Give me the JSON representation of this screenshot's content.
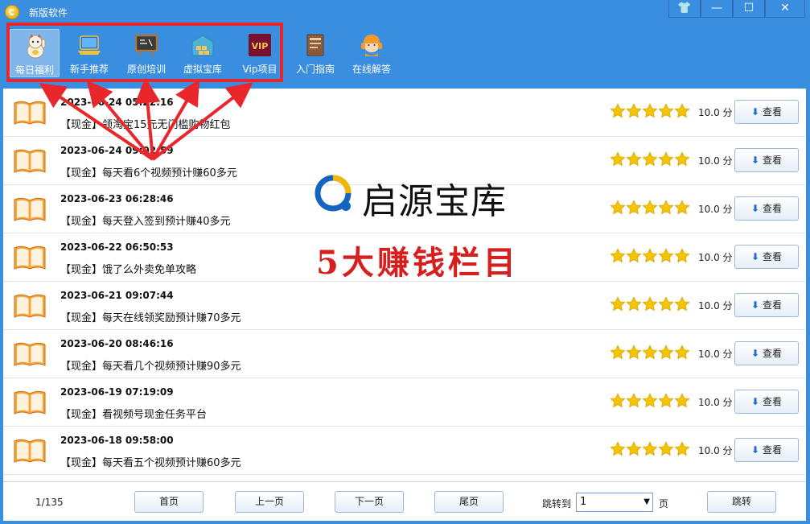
{
  "window": {
    "title": "新版软件"
  },
  "window_controls": {
    "skin": "👕",
    "minimize": "—",
    "maximize": "☐",
    "close": "✕"
  },
  "toolbar": [
    {
      "label": "每日福利",
      "icon": "lucky-cat-icon"
    },
    {
      "label": "新手推荐",
      "icon": "laptop-icon"
    },
    {
      "label": "原创培训",
      "icon": "chalkboard-icon"
    },
    {
      "label": "虚拟宝库",
      "icon": "warehouse-icon"
    },
    {
      "label": "Vip项目",
      "icon": "vip-icon",
      "badge": "VIP"
    },
    {
      "label": "入门指南",
      "icon": "guide-book-icon"
    },
    {
      "label": "在线解答",
      "icon": "support-agent-icon"
    }
  ],
  "rows": [
    {
      "date": "2023-06-24 05:22:16",
      "title": "【现金】领淘宝15元无门槛购物红包",
      "rating": 5,
      "score": "10.0 分",
      "button": "查看"
    },
    {
      "date": "2023-06-24 09:02:59",
      "title": "【现金】每天看6个视频预计赚60多元",
      "rating": 5,
      "score": "10.0 分",
      "button": "查看"
    },
    {
      "date": "2023-06-23 06:28:46",
      "title": "【现金】每天登入签到预计赚40多元",
      "rating": 5,
      "score": "10.0 分",
      "button": "查看"
    },
    {
      "date": "2023-06-22 06:50:53",
      "title": "【现金】饿了么外卖免单攻略",
      "rating": 5,
      "score": "10.0 分",
      "button": "查看"
    },
    {
      "date": "2023-06-21 09:07:44",
      "title": "【现金】每天在线领奖励预计赚70多元",
      "rating": 5,
      "score": "10.0 分",
      "button": "查看"
    },
    {
      "date": "2023-06-20 08:46:16",
      "title": "【现金】每天看几个视频预计赚90多元",
      "rating": 5,
      "score": "10.0 分",
      "button": "查看"
    },
    {
      "date": "2023-06-19 07:19:09",
      "title": "【现金】看视频号现金任务平台",
      "rating": 5,
      "score": "10.0 分",
      "button": "查看"
    },
    {
      "date": "2023-06-18 09:58:00",
      "title": "【现金】每天看五个视频预计赚60多元",
      "rating": 5,
      "score": "10.0 分",
      "button": "查看"
    }
  ],
  "footer": {
    "page_info": "1/135",
    "first": "首页",
    "prev": "上一页",
    "next": "下一页",
    "last": "尾页",
    "jump_to": "跳转到",
    "page_value": "1",
    "page_unit": "页",
    "jump": "跳转"
  },
  "overlay": {
    "logo_text": "启源宝库",
    "caption": "5大赚钱栏目"
  },
  "colors": {
    "titlebar": "#3a8ee0",
    "highlight": "#e8262b",
    "star": "#f5c400",
    "caption": "#d61f1f"
  }
}
